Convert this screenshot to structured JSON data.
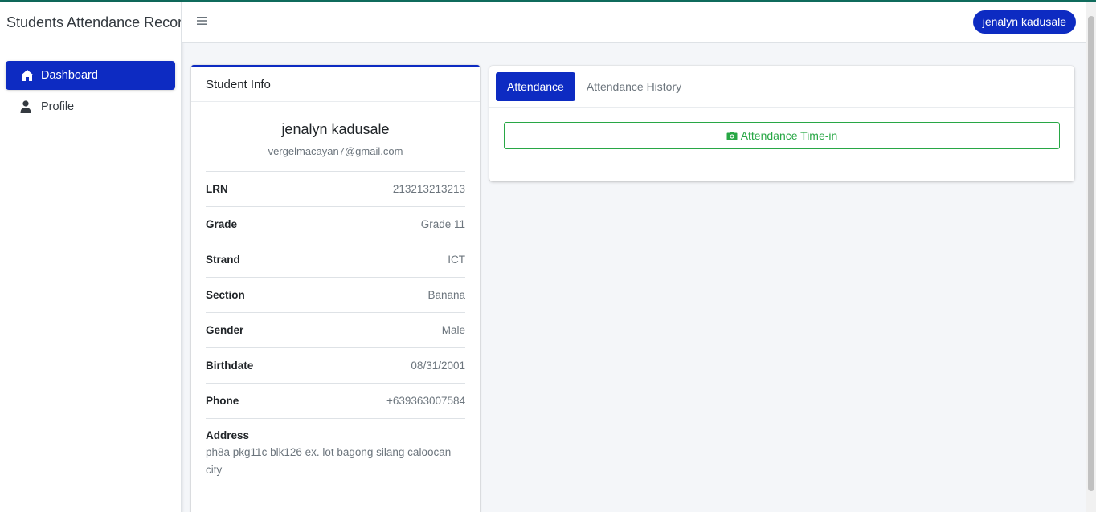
{
  "app": {
    "title": "Students Attendance Record"
  },
  "sidebar": {
    "items": [
      {
        "label": "Dashboard",
        "icon": "home-icon",
        "active": true
      },
      {
        "label": "Profile",
        "icon": "user-icon",
        "active": false
      }
    ]
  },
  "topbar": {
    "menu_icon": "hamburger-icon",
    "user_name": "jenalyn kadusale"
  },
  "student_info": {
    "header": "Student Info",
    "name": "jenalyn kadusale",
    "email": "vergelmacayan7@gmail.com",
    "fields": [
      {
        "label": "LRN",
        "value": "213213213213"
      },
      {
        "label": "Grade",
        "value": "Grade 11"
      },
      {
        "label": "Strand",
        "value": "ICT"
      },
      {
        "label": "Section",
        "value": "Banana"
      },
      {
        "label": "Gender",
        "value": "Male"
      },
      {
        "label": "Birthdate",
        "value": "08/31/2001"
      },
      {
        "label": "Phone",
        "value": "+639363007584"
      }
    ],
    "address_label": "Address",
    "address_value": "ph8a pkg11c blk126 ex. lot bagong silang caloocan city"
  },
  "attendance": {
    "tabs": [
      {
        "label": "Attendance",
        "active": true
      },
      {
        "label": "Attendance History",
        "active": false
      }
    ],
    "timein_label": "Attendance Time-in",
    "timein_icon": "camera-icon"
  },
  "colors": {
    "primary": "#0d2bc2",
    "success": "#28a745",
    "top_accent": "#0f6b5c"
  }
}
